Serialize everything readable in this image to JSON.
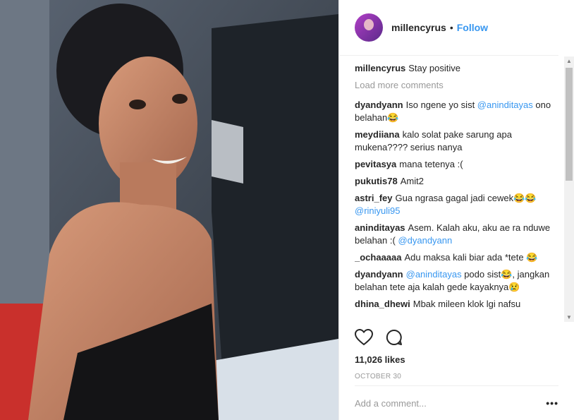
{
  "header": {
    "username": "millencyrus",
    "separator": "•",
    "follow_label": "Follow"
  },
  "caption": {
    "username": "millencyrus",
    "text": "Stay positive"
  },
  "load_more": "Load more comments",
  "comments": [
    {
      "user": "dyandyann",
      "text": "Iso ngene yo sist ",
      "mention": "@aninditayas",
      "after": " ono belahan😂"
    },
    {
      "user": "meydiiana",
      "text": "kalo solat pake sarung apa mukena???? serius nanya",
      "mention": "",
      "after": ""
    },
    {
      "user": "pevitasya",
      "text": "mana tetenya :(",
      "mention": "",
      "after": ""
    },
    {
      "user": "pukutis78",
      "text": "Amit2",
      "mention": "",
      "after": ""
    },
    {
      "user": "astri_fey",
      "text": "Gua ngrasa gagal jadi cewek😂😂 ",
      "mention": "@riniyuli95",
      "after": ""
    },
    {
      "user": "aninditayas",
      "text": "Asem. Kalah aku, aku ae ra nduwe belahan :( ",
      "mention": "@dyandyann",
      "after": ""
    },
    {
      "user": "_ochaaaaa",
      "text": "Adu maksa kali biar ada *tete 😂",
      "mention": "",
      "after": ""
    },
    {
      "user": "dyandyann",
      "text": "",
      "mention": "@aninditayas",
      "after": " podo sist😂, jangkan belahan tete aja kalah gede kayaknya😢"
    },
    {
      "user": "dhina_dhewi",
      "text": "Mbak mileen klok lgi nafsu",
      "mention": "",
      "after": ""
    }
  ],
  "icons": {
    "like": "heart-icon",
    "comment": "comment-icon",
    "more": "more-options-icon"
  },
  "likes": "11,026 likes",
  "date": "OCTOBER 30",
  "add_comment_placeholder": "Add a comment...",
  "more_label": "•••",
  "colors": {
    "link": "#3897f0",
    "muted": "#999999",
    "text": "#262626"
  }
}
